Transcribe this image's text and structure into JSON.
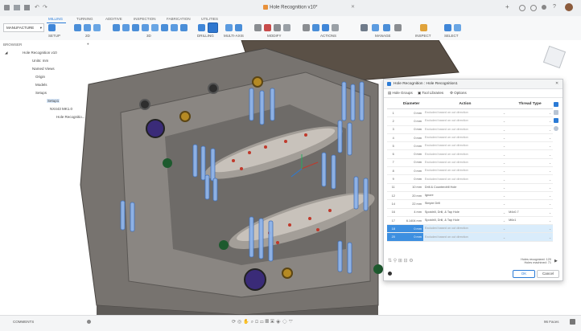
{
  "window": {
    "title": "Hole Recognition v10*"
  },
  "workspace": {
    "label": "MANUFACTURE"
  },
  "ribbon": {
    "tabs": [
      "MILLING",
      "TURNING",
      "ADDITIVE",
      "INSPECTION",
      "FABRICATION",
      "UTILITIES"
    ],
    "groups": [
      "SETUP",
      "2D",
      "3D",
      "DRILLING",
      "MULTI-AXIS",
      "MODIFY",
      "ACTIONS",
      "MANAGE",
      "INSPECT",
      "SELECT"
    ]
  },
  "browser": {
    "header": "BROWSER",
    "root": "Hole Recognition v10",
    "items": [
      "Units: mm",
      "Named Views",
      "Origin",
      "Models",
      "Setups",
      "Setup1",
      "NX443 MK1.0",
      "Hole Recognitio..."
    ]
  },
  "dialog": {
    "title": "Hole Recognition : Hole Recognition1",
    "tabs": [
      "Hole Groups",
      "Tool Libraries",
      "Options"
    ],
    "columns": [
      "",
      "Diameter",
      "Action",
      "Thread Type"
    ],
    "rows": [
      {
        "n": "1",
        "d": "0 mm",
        "a": "Excluded based on cut direction",
        "s": "",
        "dim": true
      },
      {
        "n": "2",
        "d": "0 mm",
        "a": "Excluded based on cut direction",
        "s": "",
        "dim": true
      },
      {
        "n": "3",
        "d": "0 mm",
        "a": "Excluded based on cut direction",
        "s": "",
        "dim": true
      },
      {
        "n": "4",
        "d": "0 mm",
        "a": "Excluded based on cut direction",
        "s": "",
        "dim": true
      },
      {
        "n": "5",
        "d": "0 mm",
        "a": "Excluded based on cut direction",
        "s": "",
        "dim": true
      },
      {
        "n": "6",
        "d": "0 mm",
        "a": "Excluded based on cut direction",
        "s": "",
        "dim": true
      },
      {
        "n": "7",
        "d": "0 mm",
        "a": "Excluded based on cut direction",
        "s": "",
        "dim": true
      },
      {
        "n": "8",
        "d": "0 mm",
        "a": "Excluded based on cut direction",
        "s": "",
        "dim": true
      },
      {
        "n": "9",
        "d": "0 mm",
        "a": "Excluded based on cut direction",
        "s": "",
        "dim": true
      },
      {
        "n": "11",
        "d": "10 mm",
        "a": "Drill & Counterdrill Hole",
        "s": "",
        "dim": false
      },
      {
        "n": "12",
        "d": "20 mm",
        "a": "Ignore",
        "s": "",
        "dim": false
      },
      {
        "n": "14",
        "d": "22 mm",
        "a": "Simple Drill",
        "s": "",
        "dim": false
      },
      {
        "n": "16",
        "d": "4 mm",
        "a": "Spotdrill, Drill, & Tap Hole",
        "s": "M4x0.7",
        "dim": false
      },
      {
        "n": "17",
        "d": "6.1404 mm",
        "a": "Spotdrill, Drill, & Tap Hole",
        "s": "M6x1",
        "dim": false
      },
      {
        "n": "18",
        "d": "0 mm",
        "a": "Excluded based on cut direction",
        "s": "",
        "dim": true,
        "sel": true
      },
      {
        "n": "20",
        "d": "0 mm",
        "a": "Excluded based on cut direction",
        "s": "",
        "dim": true,
        "sel": true
      }
    ],
    "summary": [
      "Holes recognized: 120",
      "Holes machined: 71"
    ],
    "ok_label": "OK",
    "cancel_label": "Cancel"
  },
  "bottom": {
    "comments": "COMMENTS",
    "status": "96 Faces"
  },
  "colors": {
    "accent": "#2b7bd6",
    "model_body": "#6e6c6a",
    "hole_blue": "#7aa6e0"
  }
}
